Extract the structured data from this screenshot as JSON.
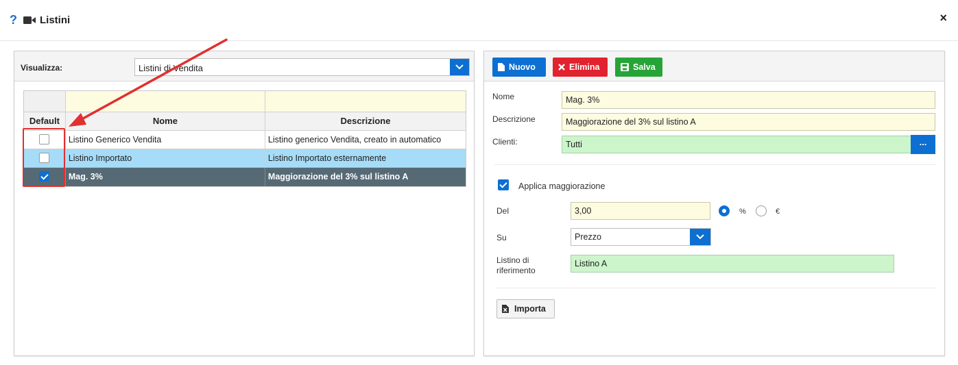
{
  "window": {
    "title": "Listini",
    "help_icon": "?",
    "close_icon": "×"
  },
  "left": {
    "visualizza_label": "Visualizza:",
    "visualizza_value": "Listini di Vendita",
    "grid": {
      "headers": [
        "Default",
        "Nome",
        "Descrizione"
      ],
      "rows": [
        {
          "default": false,
          "nome": "Listino Generico Vendita",
          "descrizione": "Listino generico Vendita, creato in automatico",
          "state": "normal"
        },
        {
          "default": false,
          "nome": "Listino Importato",
          "descrizione": "Listino Importato esternamente",
          "state": "hover"
        },
        {
          "default": true,
          "nome": "Mag. 3%",
          "descrizione": "Maggiorazione del 3% sul listino A",
          "state": "selected"
        }
      ]
    }
  },
  "right": {
    "toolbar": {
      "nuovo": "Nuovo",
      "elimina": "Elimina",
      "salva": "Salva"
    },
    "form": {
      "nome_label": "Nome",
      "nome_value": "Mag. 3%",
      "descrizione_label": "Descrizione",
      "descrizione_value": "Maggiorazione del 3% sul listino A",
      "clienti_label": "Clienti:",
      "clienti_value": "Tutti",
      "clienti_button": "...",
      "applica_label": "Applica maggiorazione",
      "applica_checked": true,
      "del_label": "Del",
      "del_value": "3,00",
      "percent_label": "%",
      "euro_label": "€",
      "su_label": "Su",
      "su_value": "Prezzo",
      "listino_rif_label_1": "Listino di",
      "listino_rif_label_2": "riferimento",
      "listino_rif_value": "Listino A",
      "importa_label": "Importa"
    }
  },
  "colors": {
    "primary": "#0d6fd1",
    "danger": "#e0232e",
    "success": "#27a437",
    "annotation": "#e03030"
  }
}
